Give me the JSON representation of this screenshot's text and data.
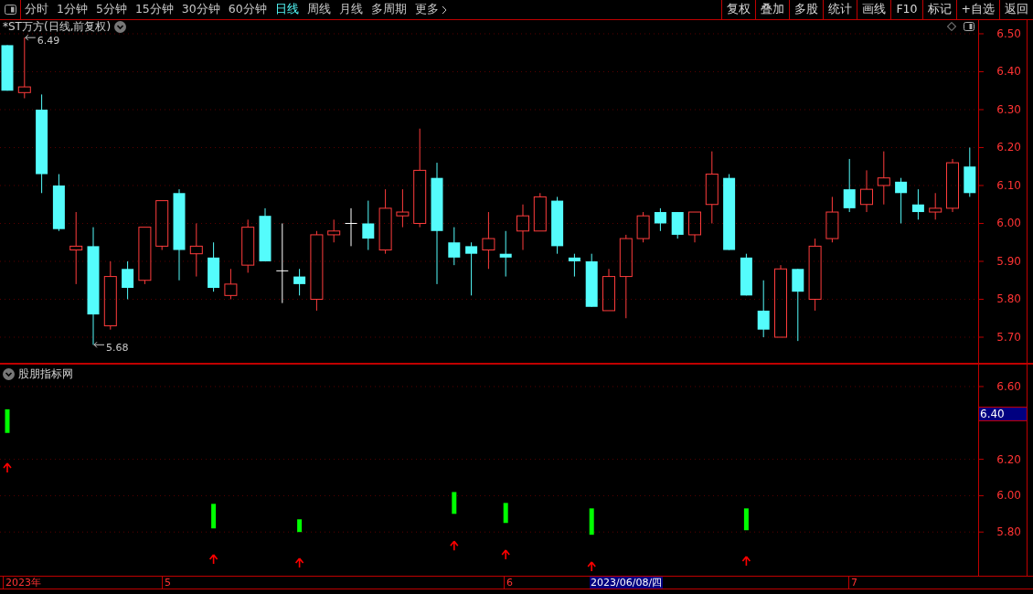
{
  "toolbar": {
    "periods": [
      {
        "label": "分时",
        "selected": false
      },
      {
        "label": "1分钟",
        "selected": false
      },
      {
        "label": "5分钟",
        "selected": false
      },
      {
        "label": "15分钟",
        "selected": false
      },
      {
        "label": "30分钟",
        "selected": false
      },
      {
        "label": "60分钟",
        "selected": false
      },
      {
        "label": "日线",
        "selected": true
      },
      {
        "label": "周线",
        "selected": false
      },
      {
        "label": "月线",
        "selected": false
      },
      {
        "label": "多周期",
        "selected": false
      },
      {
        "label": "更多",
        "selected": false
      }
    ],
    "buttons": [
      "复权",
      "叠加",
      "多股",
      "统计",
      "画线",
      "F10",
      "标记",
      "+自选",
      "返回"
    ]
  },
  "price_pane": {
    "title": "*ST万方(日线,前复权)",
    "axis_labels": [
      "6.50",
      "6.40",
      "6.30",
      "6.20",
      "6.10",
      "6.00",
      "5.90",
      "5.80",
      "5.70"
    ],
    "annotations": [
      "6.49",
      "5.68"
    ]
  },
  "indicator_pane": {
    "title": "股朋指标网",
    "cursor_value": "6.40",
    "axis_labels": [
      "6.60",
      "6.20",
      "6.00",
      "5.80"
    ]
  },
  "date_axis": [
    {
      "text": "2023年",
      "kind": "tick"
    },
    {
      "text": "5",
      "kind": "tick"
    },
    {
      "text": "6",
      "kind": "tick"
    },
    {
      "text": "2023/06/08/四",
      "kind": "cursor"
    },
    {
      "text": "7",
      "kind": "tick"
    }
  ]
}
